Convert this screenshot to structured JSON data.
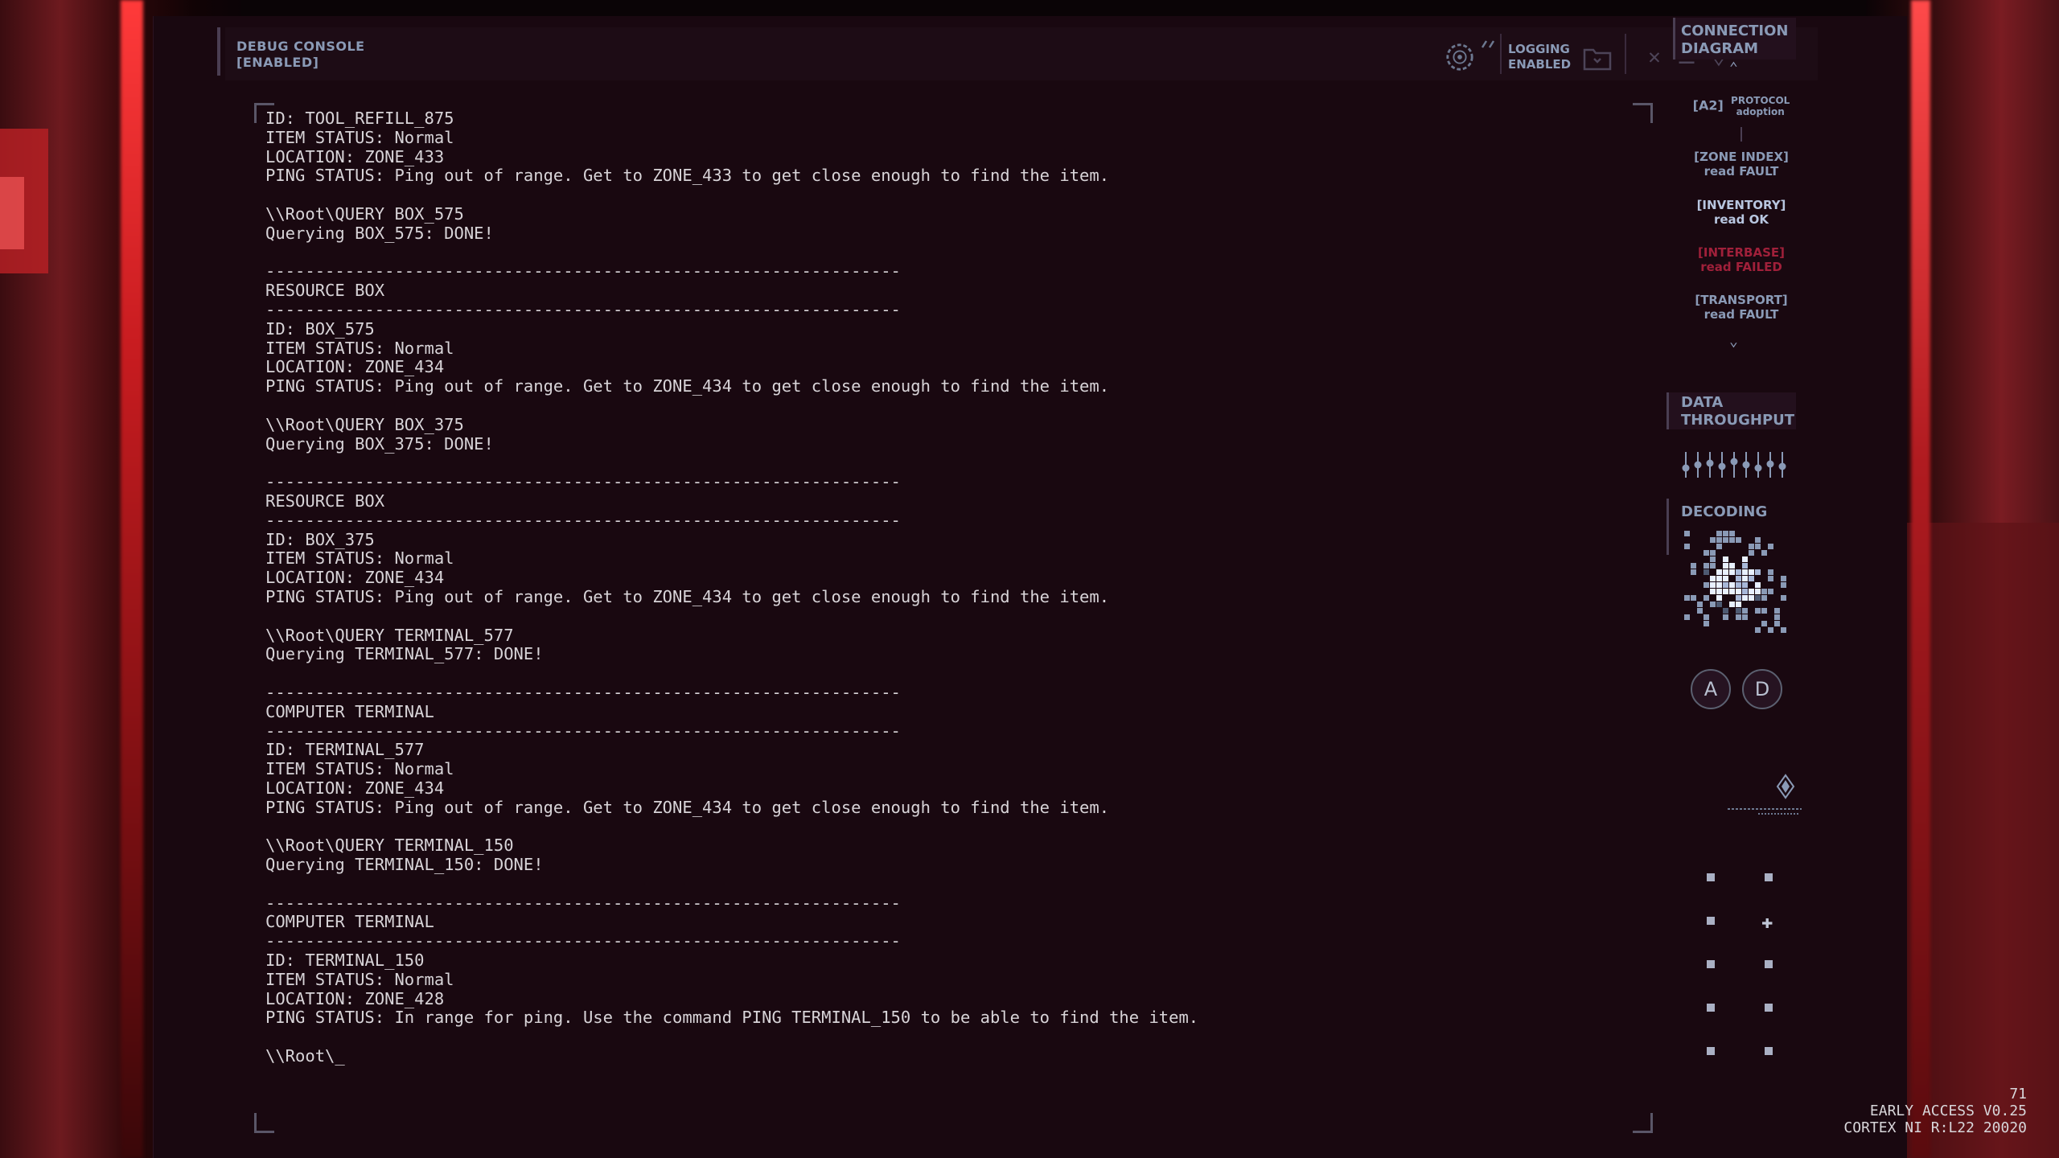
{
  "header": {
    "console_title": "DEBUG CONSOLE",
    "console_state": "[ENABLED]",
    "logging_label": "LOGGING",
    "logging_state": "ENABLED"
  },
  "terminal": {
    "lines": [
      "ID: TOOL_REFILL_875",
      "ITEM STATUS: Normal",
      "LOCATION: ZONE_433",
      "PING STATUS: Ping out of range. Get to ZONE_433 to get close enough to find the item.",
      "",
      "\\\\Root\\QUERY BOX_575",
      "Querying BOX_575: DONE!",
      "",
      "----------------------------------------------------------------",
      "RESOURCE BOX",
      "----------------------------------------------------------------",
      "ID: BOX_575",
      "ITEM STATUS: Normal",
      "LOCATION: ZONE_434",
      "PING STATUS: Ping out of range. Get to ZONE_434 to get close enough to find the item.",
      "",
      "\\\\Root\\QUERY BOX_375",
      "Querying BOX_375: DONE!",
      "",
      "----------------------------------------------------------------",
      "RESOURCE BOX",
      "----------------------------------------------------------------",
      "ID: BOX_375",
      "ITEM STATUS: Normal",
      "LOCATION: ZONE_434",
      "PING STATUS: Ping out of range. Get to ZONE_434 to get close enough to find the item.",
      "",
      "\\\\Root\\QUERY TERMINAL_577",
      "Querying TERMINAL_577: DONE!",
      "",
      "----------------------------------------------------------------",
      "COMPUTER TERMINAL",
      "----------------------------------------------------------------",
      "ID: TERMINAL_577",
      "ITEM STATUS: Normal",
      "LOCATION: ZONE_434",
      "PING STATUS: Ping out of range. Get to ZONE_434 to get close enough to find the item.",
      "",
      "\\\\Root\\QUERY TERMINAL_150",
      "Querying TERMINAL_150: DONE!",
      "",
      "----------------------------------------------------------------",
      "COMPUTER TERMINAL",
      "----------------------------------------------------------------",
      "ID: TERMINAL_150",
      "ITEM STATUS: Normal",
      "LOCATION: ZONE_428",
      "PING STATUS: In range for ping. Use the command PING TERMINAL_150 to be able to find the item.",
      "",
      "\\\\Root\\_"
    ]
  },
  "sidebar": {
    "connection_title_1": "CONNECTION",
    "connection_title_2": "DIAGRAM",
    "nodes": [
      {
        "name": "[A2]",
        "sub1": "PROTOCOL",
        "sub2": "adoption",
        "color": "#8a9ab6"
      },
      {
        "name": "[ZONE INDEX]",
        "status": "read FAULT",
        "color": "#8a9ab6"
      },
      {
        "name": "[INVENTORY]",
        "status": "read OK",
        "color": "#b8c6e0"
      },
      {
        "name": "[INTERBASE]",
        "status": "read FAILED",
        "color": "#a0203a"
      },
      {
        "name": "[TRANSPORT]",
        "status": "read FAULT",
        "color": "#8a9ab6"
      }
    ],
    "throughput_title_1": "DATA",
    "throughput_title_2": "THROUGHPUT",
    "decoding_title": "DECODING",
    "button_a": "A",
    "button_d": "D"
  },
  "version": {
    "line1": "71",
    "line2": "EARLY ACCESS V0.25",
    "line3": "CORTEX NI R:L22 20020"
  },
  "colors": {
    "accent_text": "#8a9ab6",
    "terminal_text": "#d8d4d8",
    "error": "#a0203a"
  }
}
